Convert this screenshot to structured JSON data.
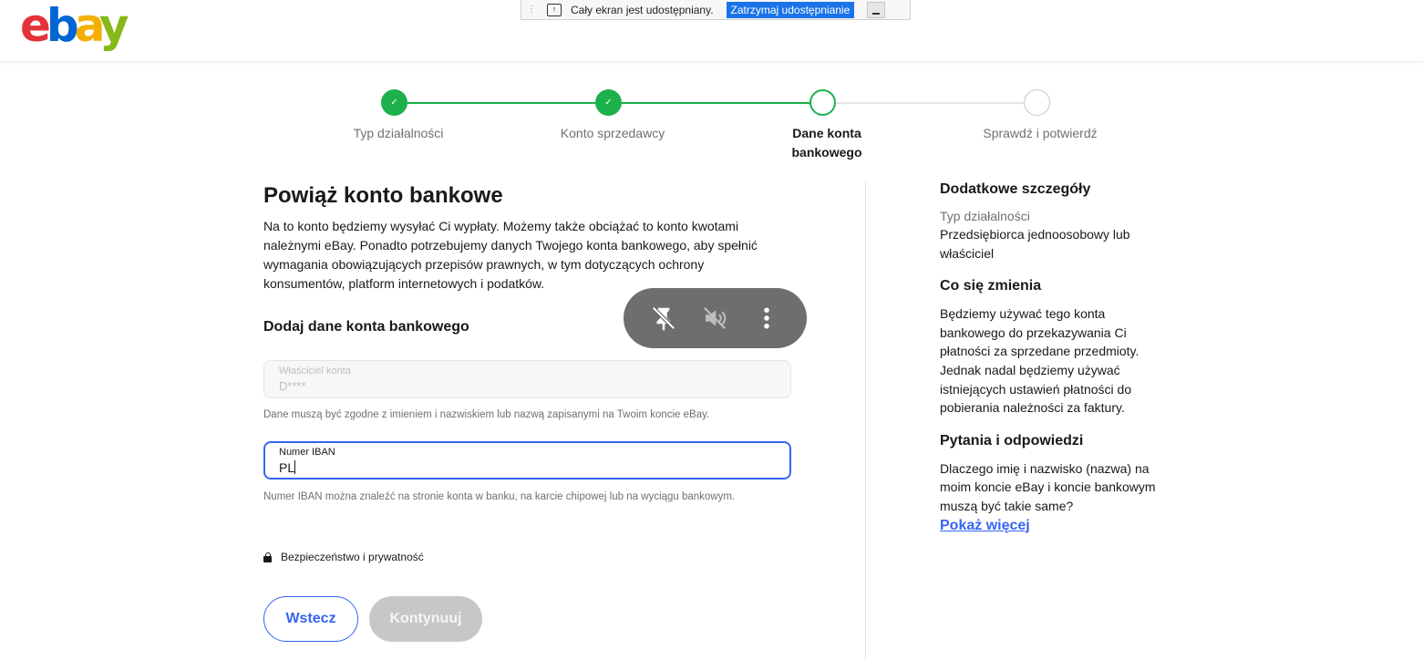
{
  "logo": {
    "e": "e",
    "b": "b",
    "a": "a",
    "y": "y"
  },
  "share_bar": {
    "text": "Cały ekran jest udostępniany.",
    "stop_label": "Zatrzymaj udostępnianie"
  },
  "stepper": {
    "steps": [
      {
        "label": "Typ działalności",
        "state": "done"
      },
      {
        "label": "Konto sprzedawcy",
        "state": "done"
      },
      {
        "label": "Dane konta bankowego",
        "state": "current"
      },
      {
        "label": "Sprawdź i potwierdź",
        "state": "future"
      }
    ],
    "check_glyph": "✓"
  },
  "main": {
    "title": "Powiąż konto bankowe",
    "description": "Na to konto będziemy wysyłać Ci wypłaty. Możemy także obciążać to konto kwotami należnymi eBay. Ponadto potrzebujemy danych Twojego konta bankowego, aby spełnić wymagania obowiązujących przepisów prawnych, w tym dotyczących ochrony konsumentów, platform internetowych i podatków.",
    "subheading": "Dodaj dane konta bankowego",
    "owner_field": {
      "label": "Właściciel konta",
      "value": "D****"
    },
    "owner_help": "Dane muszą być zgodne z imieniem i nazwiskiem lub nazwą zapisanymi na Twoim koncie eBay.",
    "iban_field": {
      "label": "Numer IBAN",
      "value": "PL"
    },
    "iban_help": "Numer IBAN można znaleźć na stronie konta w banku, na karcie chipowej lub na wyciągu bankowym.",
    "security_link": "Bezpieczeństwo i prywatność",
    "back_button": "Wstecz",
    "continue_button": "Kontynuuj"
  },
  "sidebar": {
    "details_heading": "Dodatkowe szczegóły",
    "business_type_label": "Typ działalności",
    "business_type_value": "Przedsiębiorca jednoosobowy lub właściciel",
    "changes_heading": "Co się zmienia",
    "changes_text": "Będziemy używać tego konta bankowego do przekazywania Ci płatności za sprzedane przedmioty. Jednak nadal będziemy używać istniejących ustawień płatności do pobierania należności za faktury.",
    "faq_heading": "Pytania i odpowiedzi",
    "faq_text": "Dlaczego imię i nazwisko (nazwa) na moim koncie eBay i koncie bankowym muszą być takie same?",
    "show_more": "Pokaż więcej"
  },
  "colors": {
    "accent": "#3665f3",
    "success": "#1db14b",
    "disabled": "#c7c7c7"
  },
  "overlay": {
    "icons": [
      "unpin-icon",
      "mute-icon",
      "more-vertical-icon"
    ]
  }
}
